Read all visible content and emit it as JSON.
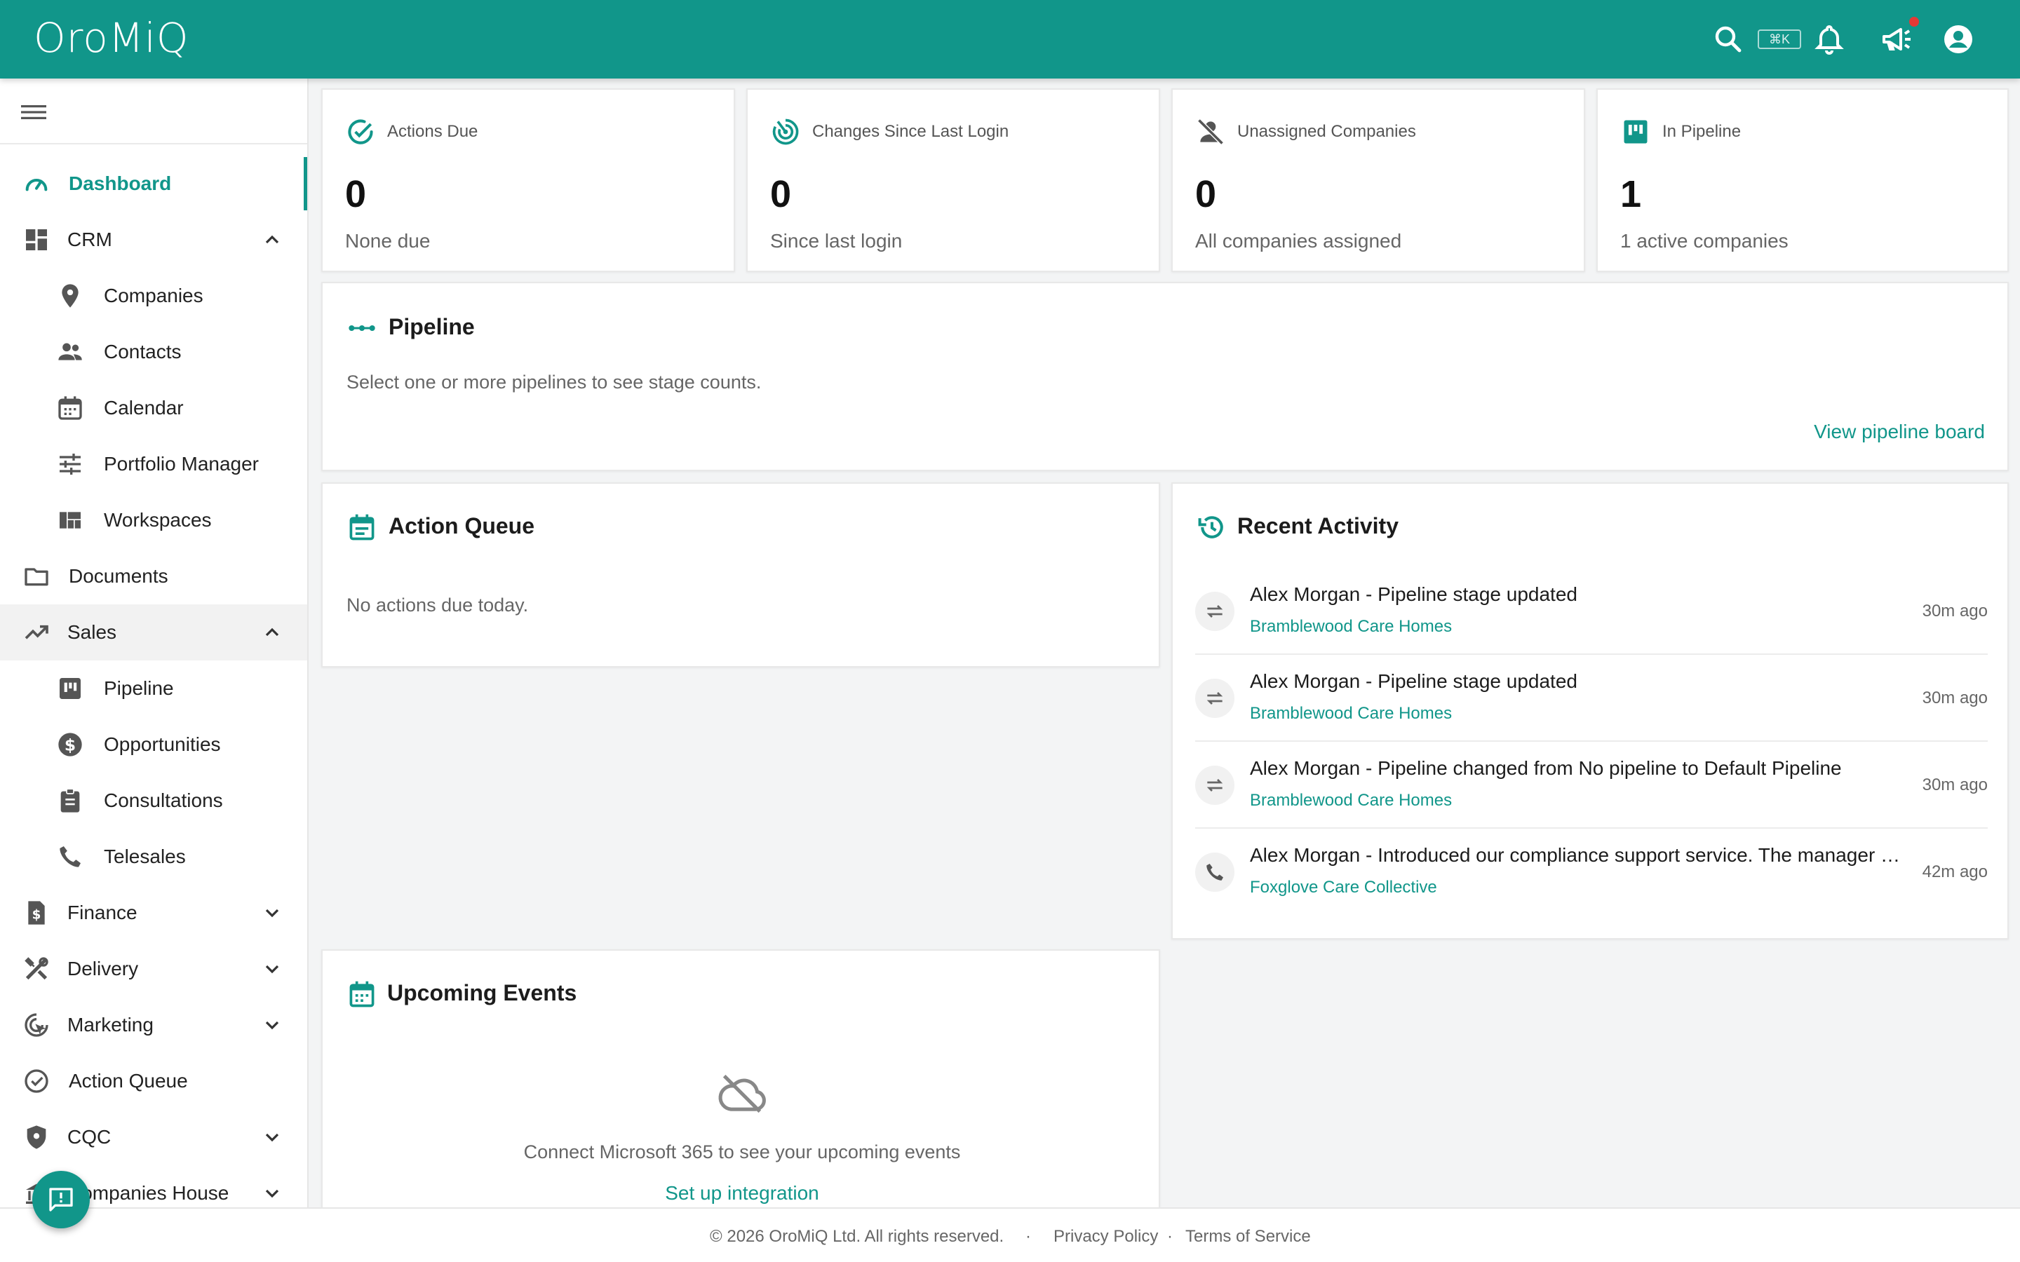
{
  "app": {
    "name": "OroMiQ"
  },
  "topbar": {
    "shortcut_hint": "⌘K",
    "icons": [
      "search-icon",
      "bell-icon",
      "megaphone-icon",
      "account-icon"
    ],
    "colors": {
      "brand": "#11968a",
      "notification_dot": "#e53935"
    }
  },
  "sidebar": {
    "dashboard": "Dashboard",
    "crm": "CRM",
    "companies": "Companies",
    "contacts": "Contacts",
    "calendar": "Calendar",
    "portfolio_manager": "Portfolio Manager",
    "workspaces": "Workspaces",
    "documents": "Documents",
    "sales": "Sales",
    "pipeline": "Pipeline",
    "opportunities": "Opportunities",
    "consultations": "Consultations",
    "telesales": "Telesales",
    "finance": "Finance",
    "delivery": "Delivery",
    "marketing": "Marketing",
    "action_queue": "Action Queue",
    "cqc": "CQC",
    "companies_house": "Companies House"
  },
  "stats": [
    {
      "title": "Actions Due",
      "value": "0",
      "subtitle": "None due",
      "icon": "check-circle-icon"
    },
    {
      "title": "Changes Since Last Login",
      "value": "0",
      "subtitle": "Since last login",
      "icon": "target-icon"
    },
    {
      "title": "Unassigned Companies",
      "value": "0",
      "subtitle": "All companies assigned",
      "icon": "person-off-icon"
    },
    {
      "title": "In Pipeline",
      "value": "1",
      "subtitle": "1 active companies",
      "icon": "kanban-icon"
    }
  ],
  "pipeline": {
    "title": "Pipeline",
    "message": "Select one or more pipelines to see stage counts.",
    "link": "View pipeline board"
  },
  "action_queue": {
    "title": "Action Queue",
    "message": "No actions due today."
  },
  "recent_activity": {
    "title": "Recent Activity",
    "items": [
      {
        "title": "Alex Morgan - Pipeline stage updated",
        "company": "Bramblewood Care Homes",
        "time": "30m ago",
        "icon": "swap-icon"
      },
      {
        "title": "Alex Morgan - Pipeline stage updated",
        "company": "Bramblewood Care Homes",
        "time": "30m ago",
        "icon": "swap-icon"
      },
      {
        "title": "Alex Morgan - Pipeline changed from No pipeline to Default Pipeline",
        "company": "Bramblewood Care Homes",
        "time": "30m ago",
        "icon": "swap-icon"
      },
      {
        "title": "Alex Morgan - Introduced our compliance support service. The manager …",
        "company": "Foxglove Care Collective",
        "time": "42m ago",
        "icon": "phone-icon"
      }
    ]
  },
  "upcoming_events": {
    "title": "Upcoming Events",
    "message": "Connect Microsoft 365 to see your upcoming events",
    "link": "Set up integration"
  },
  "footer": {
    "copyright": "© 2026 OroMiQ Ltd. All rights reserved.",
    "sep": "·",
    "privacy": "Privacy Policy",
    "terms": "Terms of Service"
  }
}
